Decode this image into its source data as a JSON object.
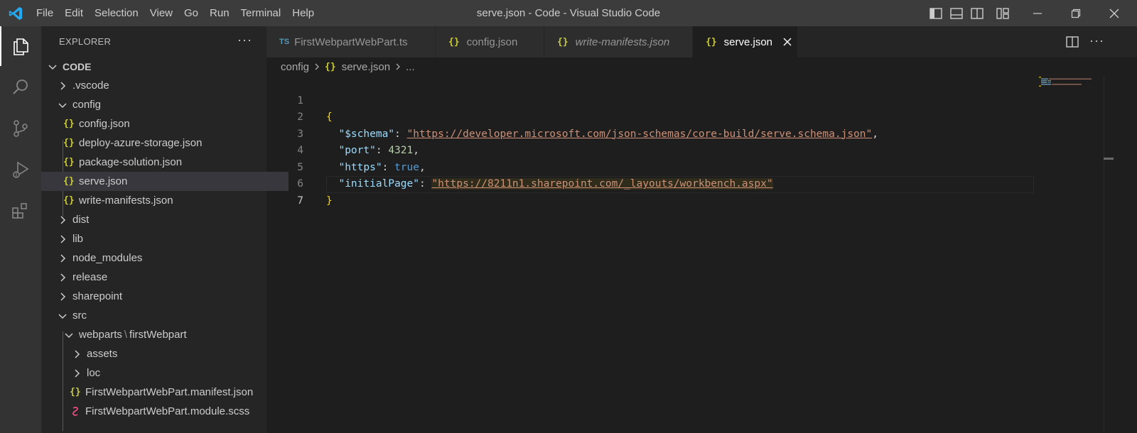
{
  "titlebar": {
    "window_title": "serve.json - Code - Visual Studio Code",
    "menu": [
      "File",
      "Edit",
      "Selection",
      "View",
      "Go",
      "Run",
      "Terminal",
      "Help"
    ]
  },
  "colors": {
    "accent": "#007acc",
    "json_icon": "#cbcb41",
    "ts_icon": "#519aba"
  },
  "activitybar": {
    "items": [
      "explorer-icon",
      "search-icon",
      "source-control-icon",
      "run-debug-icon",
      "extensions-icon"
    ]
  },
  "sidebar": {
    "header": "EXPLORER",
    "more": "···",
    "root": "CODE",
    "tree": [
      {
        "label": ".vscode",
        "type": "folder",
        "expanded": false
      },
      {
        "label": "config",
        "type": "folder",
        "expanded": true
      },
      {
        "label": "config.json",
        "type": "json"
      },
      {
        "label": "deploy-azure-storage.json",
        "type": "json"
      },
      {
        "label": "package-solution.json",
        "type": "json"
      },
      {
        "label": "serve.json",
        "type": "json",
        "selected": true
      },
      {
        "label": "write-manifests.json",
        "type": "json"
      },
      {
        "label": "dist",
        "type": "folder",
        "expanded": false
      },
      {
        "label": "lib",
        "type": "folder",
        "expanded": false
      },
      {
        "label": "node_modules",
        "type": "folder",
        "expanded": false
      },
      {
        "label": "release",
        "type": "folder",
        "expanded": false
      },
      {
        "label": "sharepoint",
        "type": "folder",
        "expanded": false
      },
      {
        "label": "src",
        "type": "folder",
        "expanded": true
      },
      {
        "label": "webparts",
        "label2": "firstWebpart",
        "type": "folder",
        "expanded": true
      },
      {
        "label": "assets",
        "type": "folder",
        "expanded": false
      },
      {
        "label": "loc",
        "type": "folder",
        "expanded": false
      },
      {
        "label": "FirstWebpartWebPart.manifest.json",
        "type": "json"
      },
      {
        "label": "FirstWebpartWebPart.module.scss",
        "type": "scss"
      }
    ]
  },
  "tabs": [
    {
      "icon": "TS",
      "label": "FirstWebpartWebPart.ts",
      "active": false,
      "italic": false
    },
    {
      "icon": "{}",
      "label": "config.json",
      "active": false,
      "italic": false
    },
    {
      "icon": "{}",
      "label": "write-manifests.json",
      "active": false,
      "italic": true
    },
    {
      "icon": "{}",
      "label": "serve.json",
      "active": true,
      "italic": false
    }
  ],
  "breadcrumb": {
    "folder": "config",
    "file": "serve.json",
    "more": "..."
  },
  "editor": {
    "line_numbers": [
      "1",
      "2",
      "3",
      "4",
      "5",
      "6",
      "7"
    ],
    "schema_key": "\"$schema\"",
    "schema_val": "\"https://developer.microsoft.com/json-schemas/core-build/serve.schema.json\"",
    "port_key": "\"port\"",
    "port_val": "4321",
    "https_key": "\"https\"",
    "https_val": "true",
    "initial_key": "\"initialPage\"",
    "initial_val": "\"https://8211n1.sharepoint.com/_layouts/workbench.aspx\"",
    "open_brace": "{",
    "close_brace": "}"
  }
}
